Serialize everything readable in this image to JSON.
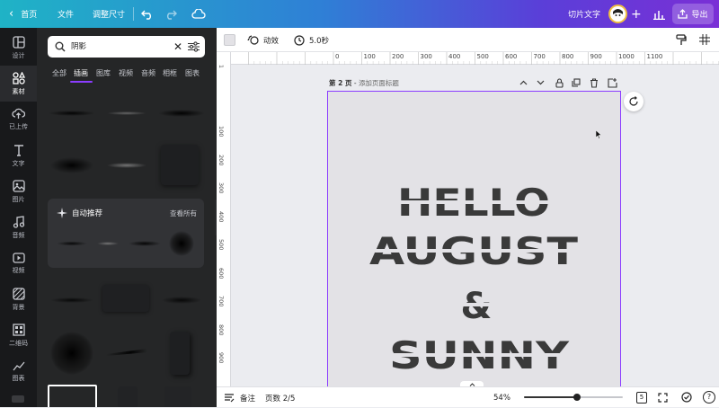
{
  "topbar": {
    "home": "首页",
    "file": "文件",
    "resize": "调整尺寸",
    "doc_title": "切片文字",
    "export": "导出"
  },
  "rail": [
    {
      "label": "设计",
      "icon": "layout-icon"
    },
    {
      "label": "素材",
      "icon": "elements-icon"
    },
    {
      "label": "已上传",
      "icon": "upload-cloud-icon"
    },
    {
      "label": "文字",
      "icon": "text-icon"
    },
    {
      "label": "图片",
      "icon": "image-icon"
    },
    {
      "label": "音频",
      "icon": "music-icon"
    },
    {
      "label": "视频",
      "icon": "video-icon"
    },
    {
      "label": "背景",
      "icon": "background-icon"
    },
    {
      "label": "二维码",
      "icon": "qr-code-icon"
    },
    {
      "label": "图表",
      "icon": "chart-icon"
    }
  ],
  "search": {
    "value": "阴影"
  },
  "tabs": [
    "全部",
    "插画",
    "图库",
    "视频",
    "音频",
    "相框",
    "图表"
  ],
  "suggestions": {
    "title": "自动推荐",
    "see_all": "查看所有"
  },
  "context": {
    "animate": "动效",
    "duration": "5.0秒"
  },
  "ruler": {
    "h": [
      "0",
      "100",
      "200",
      "300",
      "400",
      "500",
      "600",
      "700",
      "800",
      "900",
      "1000",
      "1100"
    ],
    "v": [
      "100",
      "200",
      "300",
      "400",
      "500",
      "600",
      "700",
      "800",
      "900",
      "1000"
    ],
    "v_top": "1"
  },
  "page": {
    "label": "第 2 页",
    "title_placeholder": "添加页面标题",
    "lines": [
      "HELLO",
      "AUGUST",
      "&",
      "SUNNY"
    ]
  },
  "bottom": {
    "notes": "备注",
    "pages": "页数 2/5",
    "zoom": "54%",
    "zoom_value": 54,
    "page_count_badge": "5"
  },
  "colors": {
    "accent": "#8b3dff",
    "text_slice": "#3a3a3a"
  }
}
